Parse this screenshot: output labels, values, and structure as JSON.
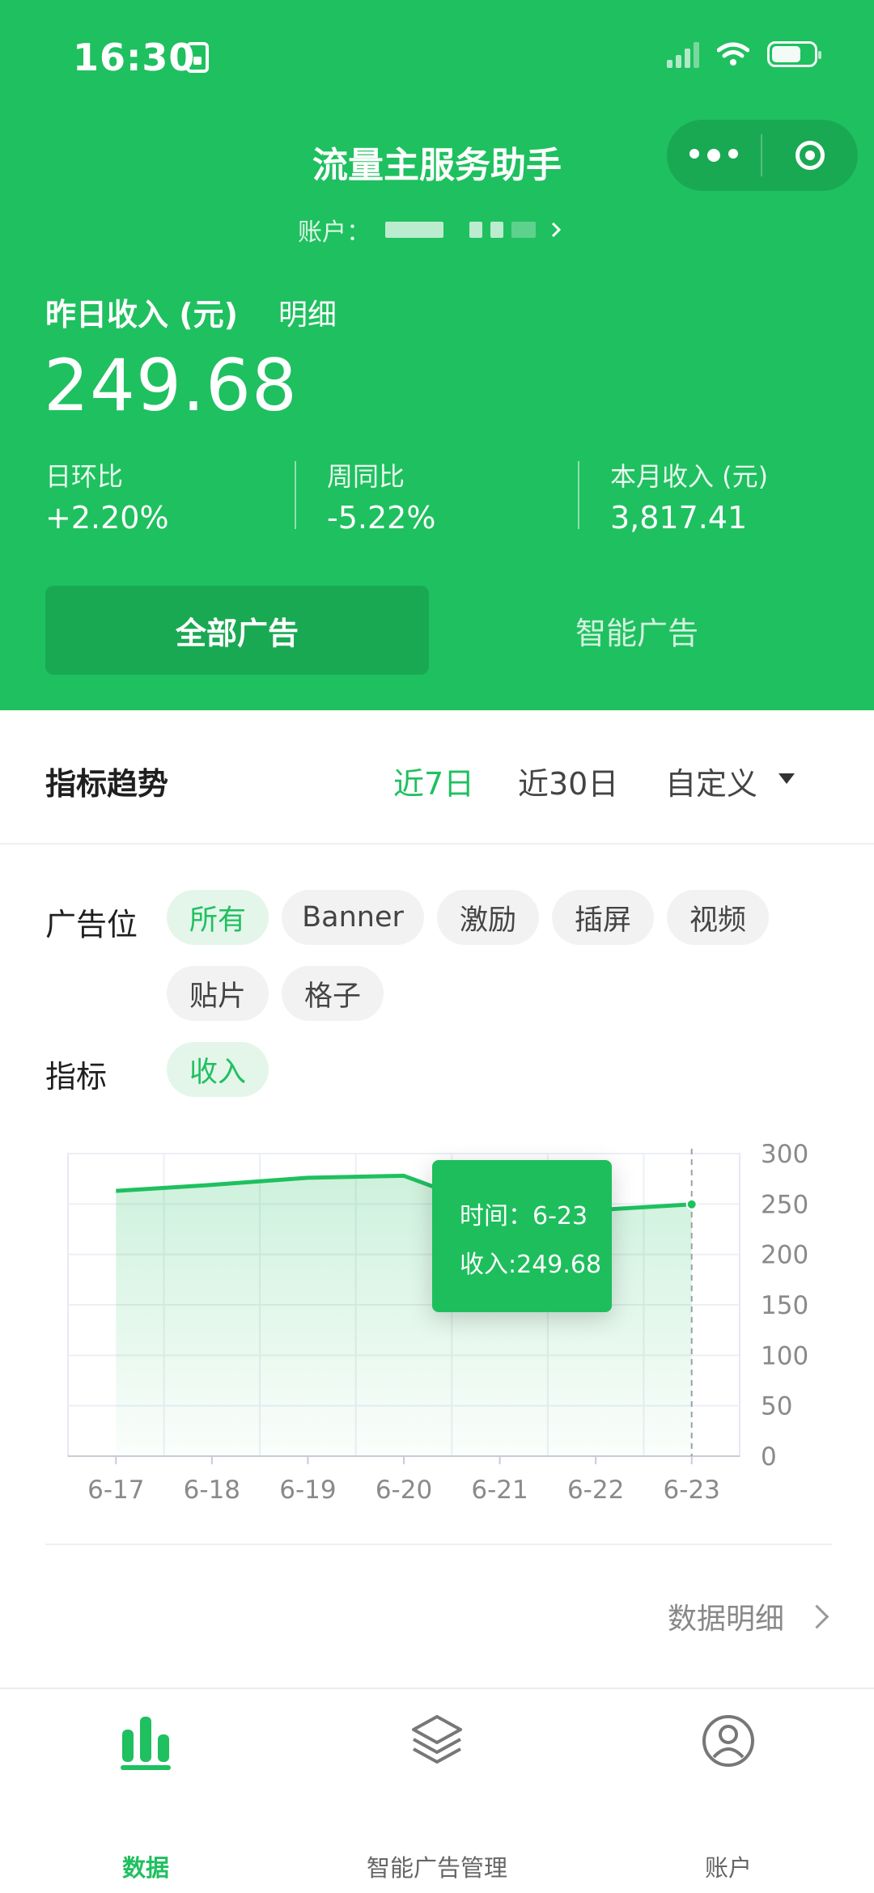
{
  "status_bar": {
    "time": "16:30"
  },
  "header": {
    "app_title": "流量主服务助手",
    "account_label": "账户："
  },
  "summary": {
    "yesterday_label": "昨日收入 (元)",
    "detail_link": "明细",
    "yesterday_income": "249.68",
    "stats": [
      {
        "label": "日环比",
        "value": "+2.20%"
      },
      {
        "label": "周同比",
        "value": "-5.22%"
      },
      {
        "label": "本月收入 (元)",
        "value": "3,817.41"
      }
    ]
  },
  "segments": {
    "all_ads": "全部广告",
    "smart_ads": "智能广告"
  },
  "trend": {
    "title": "指标趋势",
    "ranges": [
      "近7日",
      "近30日",
      "自定义"
    ],
    "active_range": "近7日"
  },
  "filters": {
    "ad_slot_label": "广告位",
    "ad_slots": [
      "所有",
      "Banner",
      "激励",
      "插屏",
      "视频",
      "贴片",
      "格子"
    ],
    "active_slot": "所有",
    "metric_label": "指标",
    "metrics": [
      "收入"
    ],
    "active_metric": "收入"
  },
  "chart_data": {
    "type": "area",
    "categories": [
      "6-17",
      "6-18",
      "6-19",
      "6-20",
      "6-21",
      "6-22",
      "6-23"
    ],
    "series": [
      {
        "values": [
          263,
          269,
          276,
          278,
          243,
          244,
          249.68
        ]
      }
    ],
    "ylim": [
      0,
      300
    ],
    "yticks": [
      "300",
      "250",
      "200",
      "150",
      "100",
      "50",
      "0"
    ],
    "grid": true,
    "line_color": "#1fc05f",
    "tooltip": {
      "time_label": "时间：",
      "time_value": "6-23",
      "income_label": "收入:",
      "income_value": "249.68"
    }
  },
  "footer": {
    "data_detail_link": "数据明细"
  },
  "tabbar": {
    "items": [
      {
        "label": "数据",
        "icon": "bar-chart-icon"
      },
      {
        "label": "智能广告管理",
        "icon": "layers-icon"
      },
      {
        "label": "账户",
        "icon": "user-icon"
      }
    ],
    "active": "数据"
  },
  "colors": {
    "brand_green": "#1fc05f",
    "brand_green_dark": "#1aa953"
  }
}
